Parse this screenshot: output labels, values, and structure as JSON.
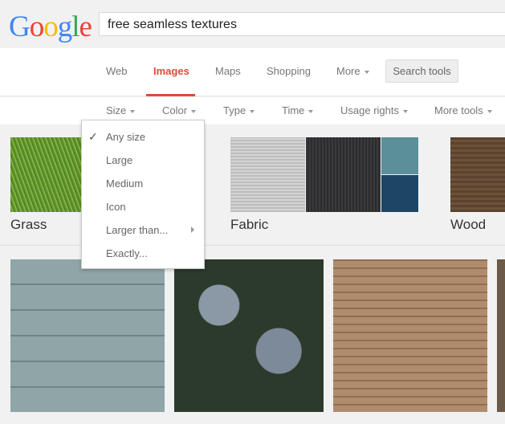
{
  "header": {
    "logo": "Google",
    "query": "free seamless textures",
    "logo_colors": [
      "#4285f4",
      "#ea4335",
      "#fbbc05",
      "#4285f4",
      "#34a853",
      "#ea4335"
    ]
  },
  "nav": {
    "tabs": [
      "Web",
      "Images",
      "Maps",
      "Shopping",
      "More"
    ],
    "active": "Images",
    "search_tools": "Search tools",
    "accent": "#dd4b39"
  },
  "tools": [
    "Size",
    "Color",
    "Type",
    "Time",
    "Usage rights",
    "More tools"
  ],
  "size_menu": {
    "items": [
      "Any size",
      "Large",
      "Medium",
      "Icon",
      "Larger than...",
      "Exactly..."
    ],
    "selected": "Any size",
    "check_icon": "checkmark-icon",
    "submenu_icon": "chevron-right-icon"
  },
  "categories": [
    "Grass",
    "Fabric",
    "Wood"
  ]
}
